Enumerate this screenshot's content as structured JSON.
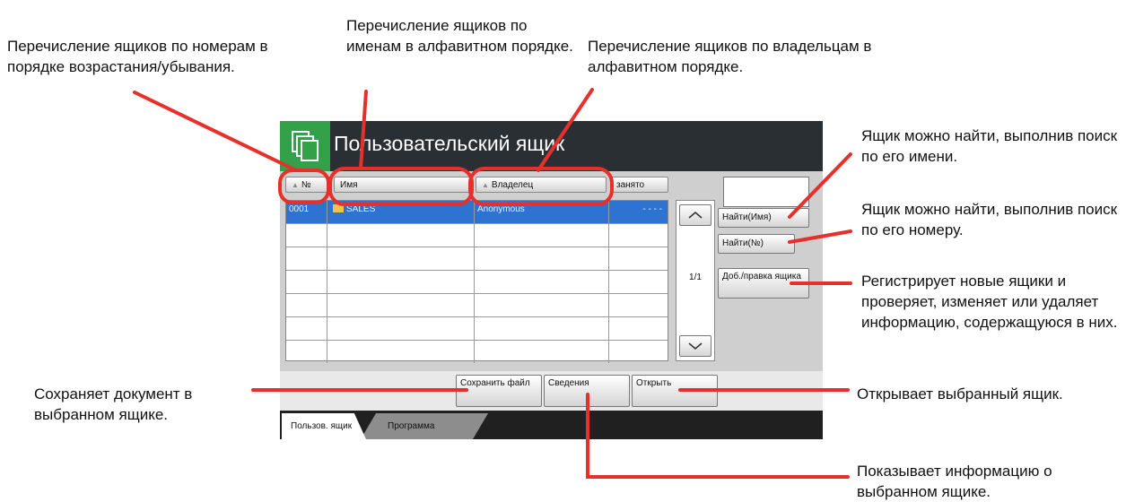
{
  "screen": {
    "title": "Пользовательский ящик",
    "columns": {
      "number": "№",
      "name": "Имя",
      "owner": "Владелец",
      "used": "занято"
    },
    "rows": [
      {
        "number": "0001",
        "name": "SALES",
        "owner": "Anonymous",
        "used": "- - - -"
      },
      {
        "number": "",
        "name": "",
        "owner": "",
        "used": ""
      },
      {
        "number": "",
        "name": "",
        "owner": "",
        "used": ""
      },
      {
        "number": "",
        "name": "",
        "owner": "",
        "used": ""
      },
      {
        "number": "",
        "name": "",
        "owner": "",
        "used": ""
      },
      {
        "number": "",
        "name": "",
        "owner": "",
        "used": ""
      },
      {
        "number": "",
        "name": "",
        "owner": "",
        "used": ""
      }
    ],
    "page_indicator": "1/1",
    "buttons": {
      "find_name": "Найти(Имя)",
      "find_number": "Найти(№)",
      "add_edit": "Доб./правка ящика",
      "save_file": "Сохранить файл",
      "details": "Сведения",
      "open": "Открыть"
    },
    "tabs": [
      "Пользов. ящик",
      "Программа"
    ]
  },
  "annotations": {
    "sort_number": "Перечисление ящиков по номерам в порядке возрастания/убывания.",
    "sort_name": "Перечисление ящиков по именам в алфавитном порядке.",
    "sort_owner": "Перечисление ящиков по владельцам в алфавитном порядке.",
    "find_name": "Ящик можно найти, выполнив поиск по его имени.",
    "find_number": "Ящик можно найти, выполнив поиск по его номеру.",
    "add_edit": "Регистрирует новые ящики и проверяет, изменяет или удаляет информацию, содержащуюся в них.",
    "save_file": "Сохраняет документ в выбранном ящике.",
    "open": "Открывает выбранный ящик.",
    "details": "Показывает информацию о выбранном ящике."
  },
  "colors": {
    "callout_red": "#e5302b",
    "title_bg": "#2a2f33",
    "home_green": "#33a04a",
    "selection_blue": "#2e73d2"
  }
}
